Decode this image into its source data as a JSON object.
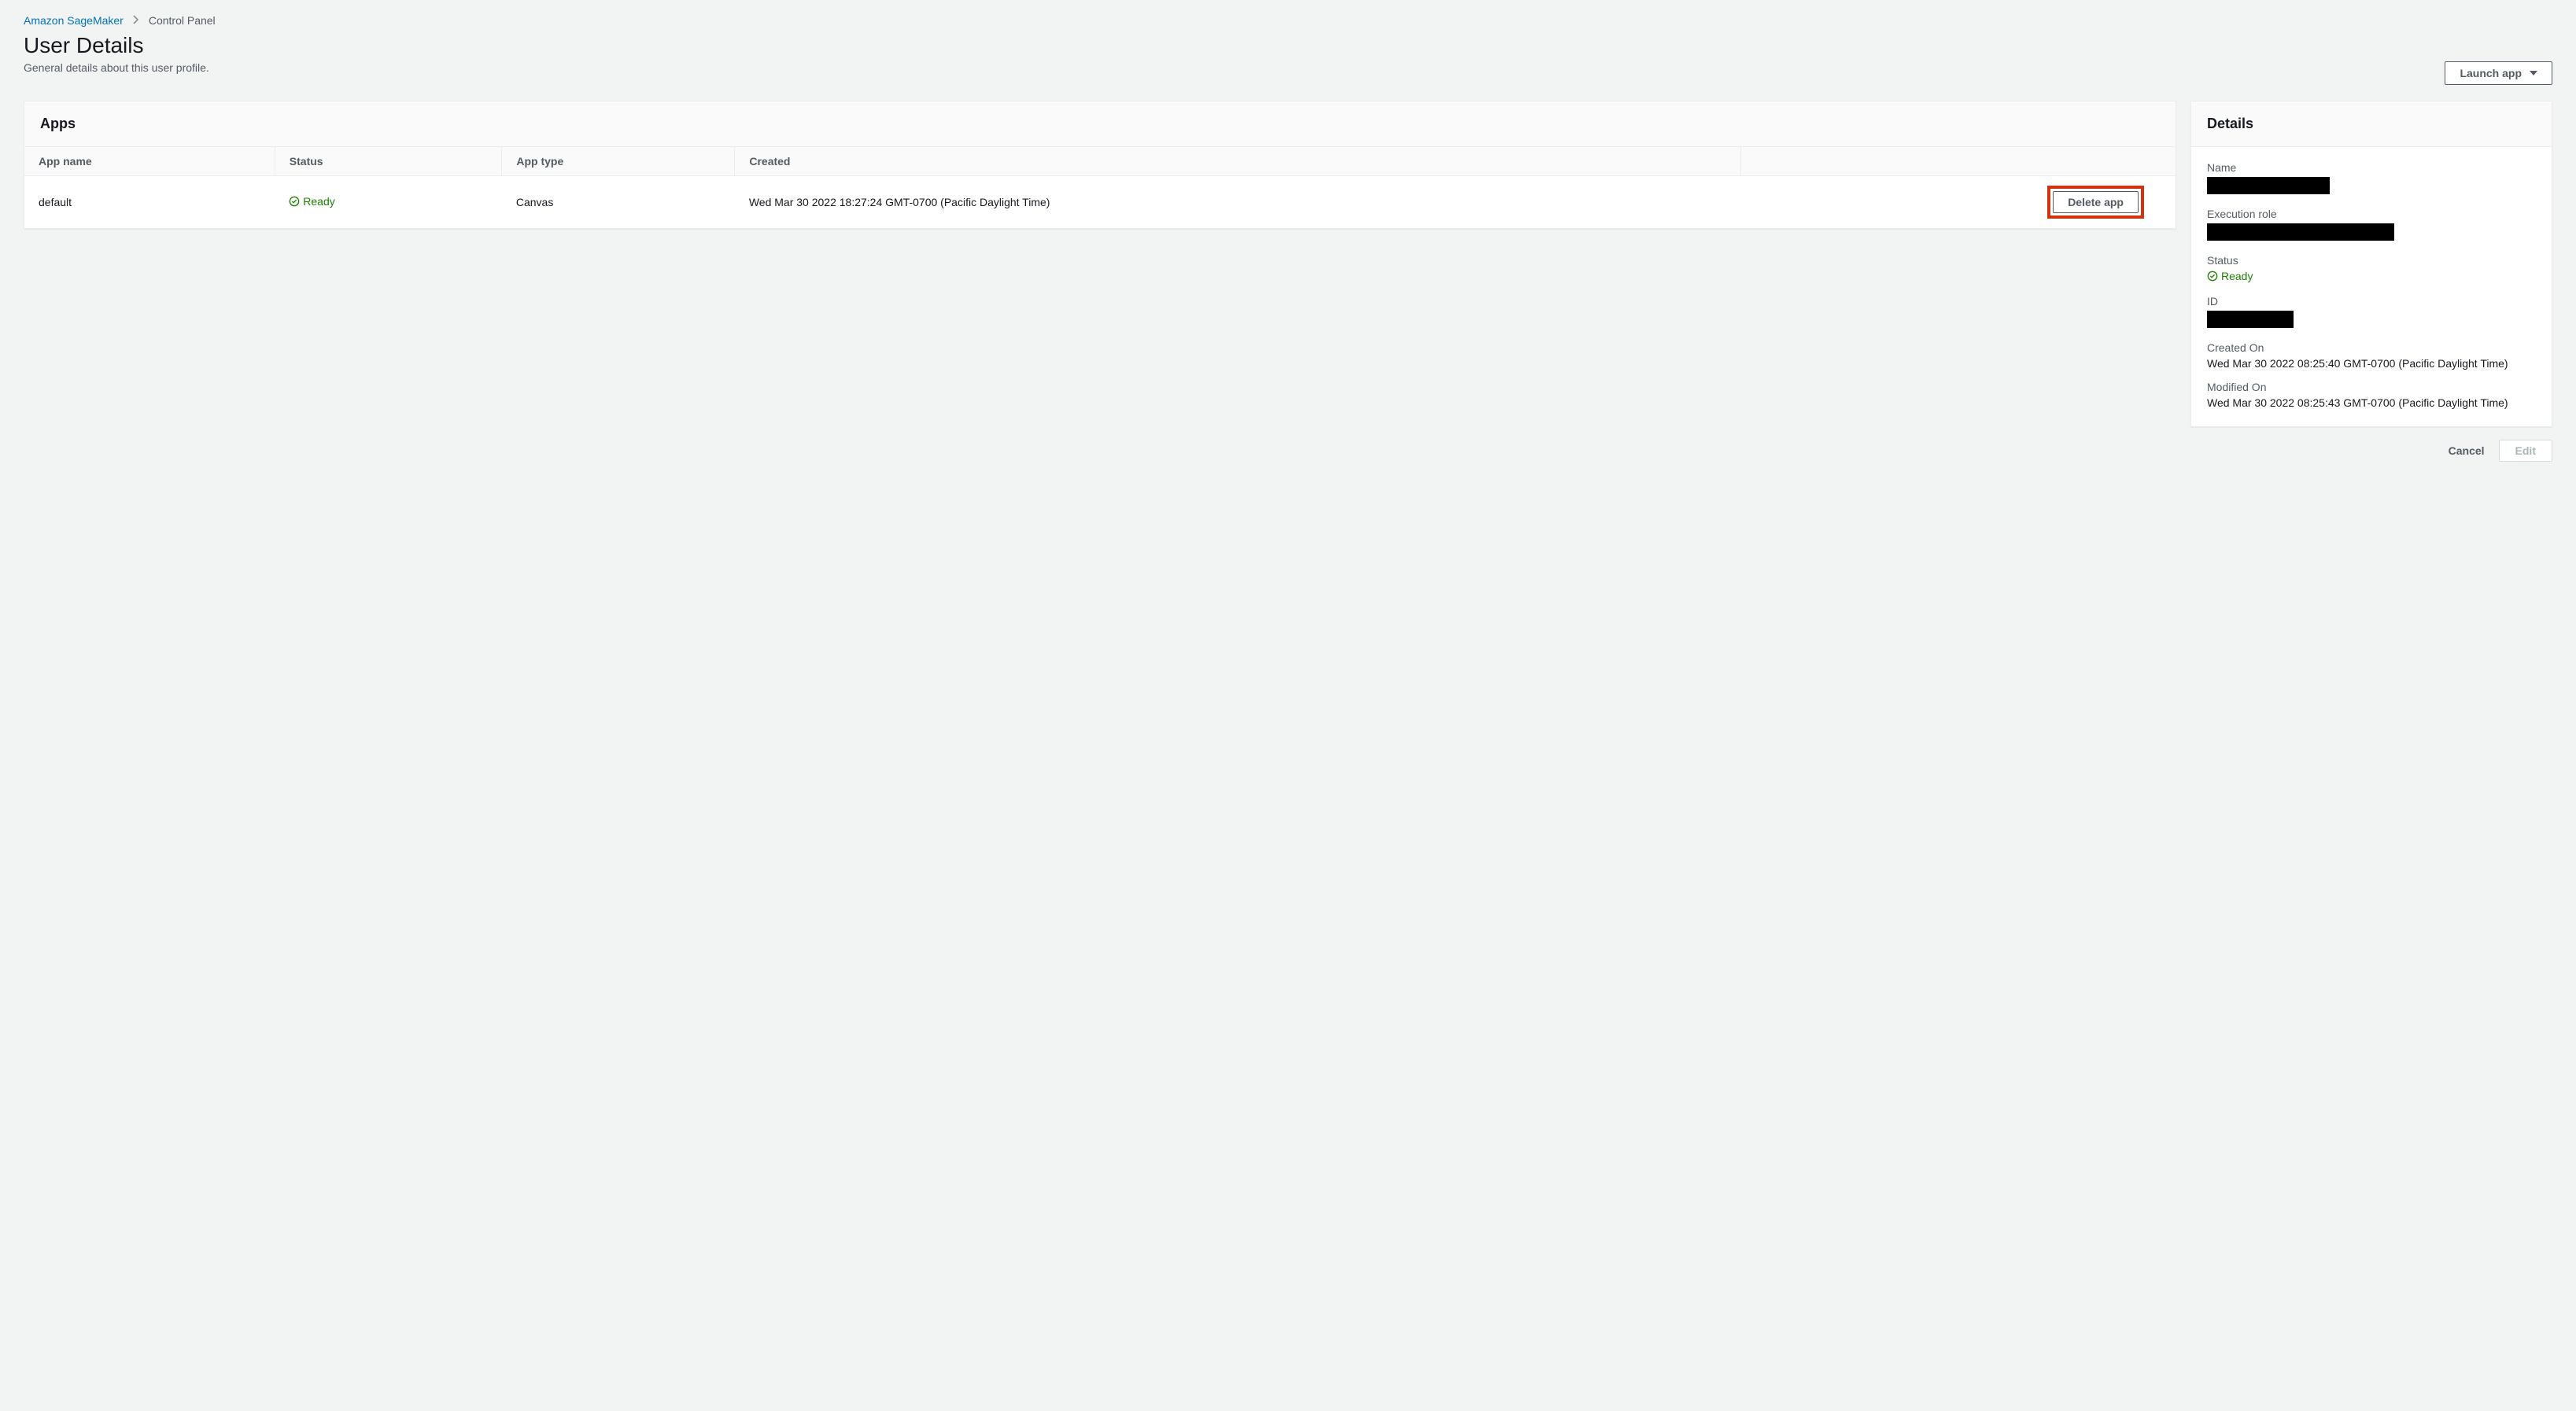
{
  "breadcrumb": {
    "root": "Amazon SageMaker",
    "current": "Control Panel"
  },
  "page": {
    "title": "User Details",
    "subtitle": "General details about this user profile.",
    "launch_button": "Launch app"
  },
  "apps": {
    "header": "Apps",
    "columns": {
      "name": "App name",
      "status": "Status",
      "type": "App type",
      "created": "Created"
    },
    "rows": [
      {
        "name": "default",
        "status": "Ready",
        "type": "Canvas",
        "created": "Wed Mar 30 2022 18:27:24 GMT-0700 (Pacific Daylight Time)",
        "delete_label": "Delete app"
      }
    ]
  },
  "details": {
    "header": "Details",
    "labels": {
      "name": "Name",
      "execution_role": "Execution role",
      "status": "Status",
      "id": "ID",
      "created_on": "Created On",
      "modified_on": "Modified On"
    },
    "values": {
      "status": "Ready",
      "created_on": "Wed Mar 30 2022 08:25:40 GMT-0700 (Pacific Daylight Time)",
      "modified_on": "Wed Mar 30 2022 08:25:43 GMT-0700 (Pacific Daylight Time)"
    }
  },
  "footer": {
    "cancel": "Cancel",
    "edit": "Edit"
  }
}
